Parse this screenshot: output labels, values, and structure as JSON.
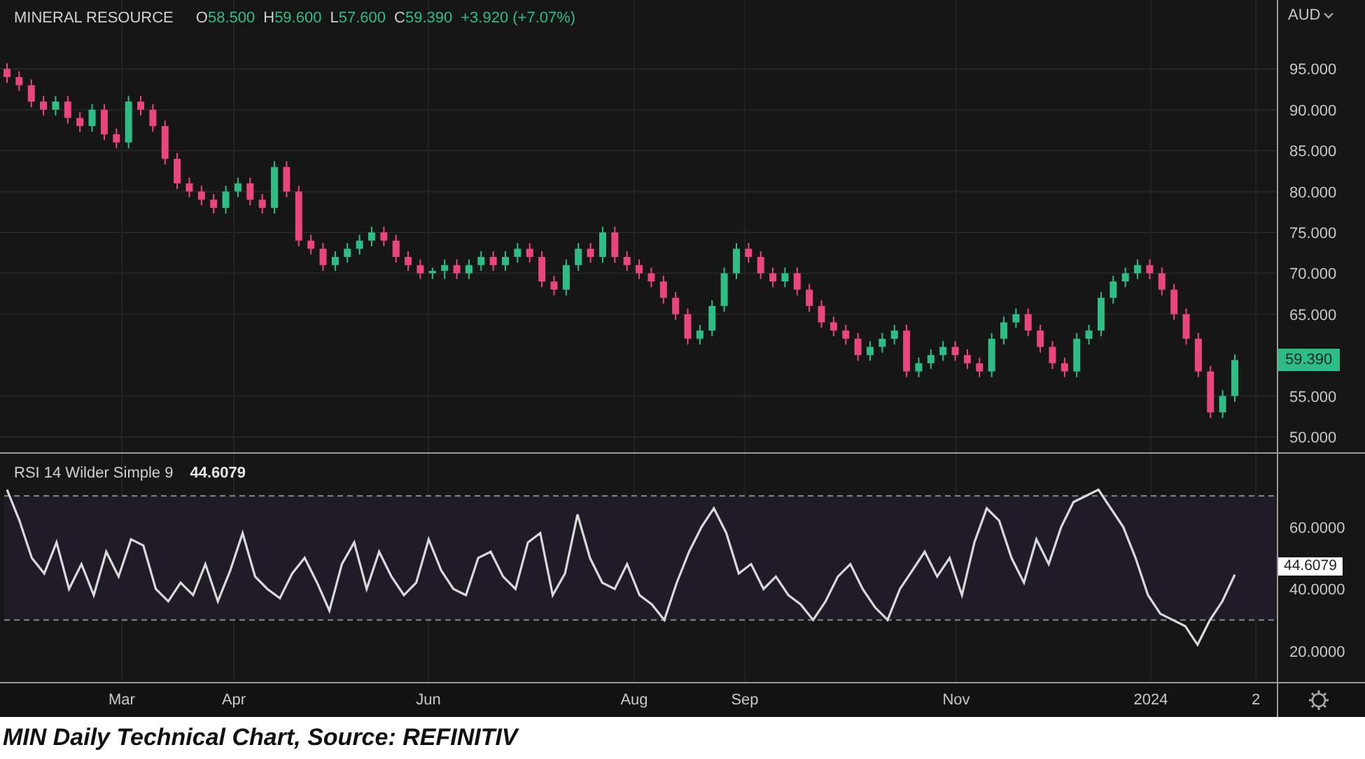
{
  "header": {
    "title": "MINERAL RESOURCE",
    "ohlc": [
      {
        "label": "O",
        "value": "58.500"
      },
      {
        "label": "H",
        "value": "59.600"
      },
      {
        "label": "L",
        "value": "57.600"
      },
      {
        "label": "C",
        "value": "59.390"
      }
    ],
    "change": "+3.920 (+7.07%)"
  },
  "currency": "AUD",
  "price_chart": {
    "last_price": "59.390",
    "chart_data": {
      "type": "candlestick",
      "grid": true,
      "ylim": [
        48.11,
        103.42
      ],
      "yticks": [
        {
          "value": 50,
          "label": "50.000"
        },
        {
          "value": 55,
          "label": "55.000"
        },
        {
          "value": 65,
          "label": "65.000"
        },
        {
          "value": 70,
          "label": "70.000"
        },
        {
          "value": 75,
          "label": "75.000"
        },
        {
          "value": 80,
          "label": "80.000"
        },
        {
          "value": 85,
          "label": "85.000"
        },
        {
          "value": 90,
          "label": "90.000"
        },
        {
          "value": 95,
          "label": "95.000"
        }
      ],
      "ohlc": [
        [
          95,
          95.7,
          93.3,
          94
        ],
        [
          94,
          94.7,
          92.3,
          93
        ],
        [
          93,
          93.7,
          90.3,
          91
        ],
        [
          91,
          91.7,
          89.3,
          90
        ],
        [
          90,
          91.7,
          89.3,
          91
        ],
        [
          91,
          91.7,
          88.3,
          89
        ],
        [
          89,
          89.7,
          87.3,
          88
        ],
        [
          88,
          90.7,
          87.3,
          90
        ],
        [
          90,
          90.7,
          86.3,
          87
        ],
        [
          87,
          87.7,
          85.3,
          86
        ],
        [
          86,
          91.7,
          85.3,
          91
        ],
        [
          91,
          91.7,
          89.3,
          90
        ],
        [
          90,
          90.7,
          87.3,
          88
        ],
        [
          88,
          88.7,
          83.3,
          84
        ],
        [
          84,
          84.7,
          80.3,
          81
        ],
        [
          81,
          81.7,
          79.3,
          80
        ],
        [
          80,
          80.7,
          78.3,
          79
        ],
        [
          79,
          79.7,
          77.3,
          78
        ],
        [
          78,
          80.7,
          77.3,
          80
        ],
        [
          80,
          81.7,
          79.3,
          81
        ],
        [
          81,
          81.7,
          78.3,
          79
        ],
        [
          79,
          79.7,
          77.3,
          78
        ],
        [
          78,
          83.7,
          77.3,
          83
        ],
        [
          83,
          83.7,
          79.3,
          80
        ],
        [
          80,
          80.7,
          73.3,
          74
        ],
        [
          74,
          74.7,
          72.3,
          73
        ],
        [
          73,
          73.7,
          70.3,
          71
        ],
        [
          71,
          72.7,
          70.3,
          72
        ],
        [
          72,
          73.7,
          71.3,
          73
        ],
        [
          73,
          74.7,
          72.3,
          74
        ],
        [
          74,
          75.7,
          73.3,
          75
        ],
        [
          75,
          75.7,
          73.3,
          74
        ],
        [
          74,
          74.7,
          71.3,
          72
        ],
        [
          72,
          72.7,
          70.3,
          71
        ],
        [
          71,
          71.7,
          69.3,
          70
        ],
        [
          70,
          70.7,
          69.3,
          70.3
        ],
        [
          70.3,
          71.7,
          69.3,
          71
        ],
        [
          71,
          71.7,
          69.3,
          70
        ],
        [
          70,
          71.7,
          69.3,
          71
        ],
        [
          71,
          72.7,
          70.3,
          72
        ],
        [
          72,
          72.7,
          70.3,
          71
        ],
        [
          71,
          72.7,
          70.3,
          72
        ],
        [
          72,
          73.7,
          71.3,
          73
        ],
        [
          73,
          73.7,
          71.3,
          72
        ],
        [
          72,
          72.7,
          68.3,
          69
        ],
        [
          69,
          69.7,
          67.3,
          68
        ],
        [
          68,
          71.7,
          67.3,
          71
        ],
        [
          71,
          73.7,
          70.3,
          73
        ],
        [
          73,
          73.7,
          71.3,
          72
        ],
        [
          72,
          75.7,
          71.3,
          75
        ],
        [
          75,
          75.7,
          71.3,
          72
        ],
        [
          72,
          72.7,
          70.3,
          71
        ],
        [
          71,
          71.7,
          69.3,
          70
        ],
        [
          70,
          70.7,
          68.3,
          69
        ],
        [
          69,
          69.7,
          66.3,
          67
        ],
        [
          67,
          67.7,
          64.3,
          65
        ],
        [
          65,
          65.7,
          61.3,
          62
        ],
        [
          62,
          63.7,
          61.3,
          63
        ],
        [
          63,
          66.7,
          62.3,
          66
        ],
        [
          66,
          70.7,
          65.3,
          70
        ],
        [
          70,
          73.7,
          69.3,
          73
        ],
        [
          73,
          73.7,
          71.3,
          72
        ],
        [
          72,
          72.7,
          69.3,
          70
        ],
        [
          70,
          70.7,
          68.3,
          69
        ],
        [
          69,
          70.7,
          68.3,
          70
        ],
        [
          70,
          70.7,
          67.3,
          68
        ],
        [
          68,
          68.7,
          65.3,
          66
        ],
        [
          66,
          66.7,
          63.3,
          64
        ],
        [
          64,
          64.7,
          62.3,
          63
        ],
        [
          63,
          63.7,
          61.3,
          62
        ],
        [
          62,
          62.7,
          59.3,
          60
        ],
        [
          60,
          61.7,
          59.3,
          61
        ],
        [
          61,
          62.7,
          60.3,
          62
        ],
        [
          62,
          63.7,
          61.3,
          63
        ],
        [
          63,
          63.7,
          57.3,
          58
        ],
        [
          58,
          59.7,
          57.3,
          59
        ],
        [
          59,
          60.7,
          58.3,
          60
        ],
        [
          60,
          61.7,
          59.3,
          61
        ],
        [
          61,
          61.7,
          59.3,
          60
        ],
        [
          60,
          60.7,
          58.3,
          59
        ],
        [
          59,
          59.7,
          57.3,
          58
        ],
        [
          58,
          62.7,
          57.3,
          62
        ],
        [
          62,
          64.7,
          61.3,
          64
        ],
        [
          64,
          65.7,
          63.3,
          65
        ],
        [
          65,
          65.7,
          62.3,
          63
        ],
        [
          63,
          63.7,
          60.3,
          61
        ],
        [
          61,
          61.7,
          58.3,
          59
        ],
        [
          59,
          59.7,
          57.3,
          58
        ],
        [
          58,
          62.7,
          57.3,
          62
        ],
        [
          62,
          63.7,
          61.3,
          63
        ],
        [
          63,
          67.7,
          62.3,
          67
        ],
        [
          67,
          69.7,
          66.3,
          69
        ],
        [
          69,
          70.7,
          68.3,
          70
        ],
        [
          70,
          71.7,
          69.3,
          71
        ],
        [
          71,
          71.7,
          69.3,
          70
        ],
        [
          70,
          70.7,
          67.3,
          68
        ],
        [
          68,
          68.7,
          64.3,
          65
        ],
        [
          65,
          65.7,
          61.3,
          62
        ],
        [
          62,
          62.7,
          57.3,
          58
        ],
        [
          58,
          58.7,
          52.3,
          53
        ],
        [
          53,
          55.7,
          52.3,
          55
        ],
        [
          55,
          60.1,
          54.3,
          59.4
        ]
      ]
    }
  },
  "rsi": {
    "label": "RSI 14 Wilder Simple 9",
    "reading": "44.6079",
    "last_value": "44.6079",
    "chart_data": {
      "type": "line",
      "ylim": [
        10,
        83.6
      ],
      "ref_lines": [
        {
          "axis": "y",
          "value": 30
        },
        {
          "axis": "y",
          "value": 70
        }
      ],
      "bands": [
        {
          "axis": "y",
          "from": 30,
          "to": 70
        }
      ],
      "yticks": [
        {
          "value": 20,
          "label": "20.0000"
        },
        {
          "value": 40,
          "label": "40.0000"
        },
        {
          "value": 60,
          "label": "60.0000"
        }
      ],
      "series": [
        {
          "color": "#d9d9d9",
          "values": [
            72,
            62,
            50,
            45,
            55,
            40,
            48,
            38,
            52,
            44,
            56,
            54,
            40,
            36,
            42,
            38,
            48,
            36,
            46,
            58,
            44,
            40,
            37,
            45,
            50,
            42,
            33,
            48,
            55,
            40,
            52,
            44,
            38,
            42,
            56,
            46,
            40,
            38,
            50,
            52,
            44,
            40,
            55,
            58,
            38,
            45,
            64,
            50,
            42,
            40,
            48,
            38,
            35,
            30,
            42,
            52,
            60,
            66,
            58,
            45,
            48,
            40,
            44,
            38,
            35,
            30,
            36,
            44,
            48,
            40,
            34,
            30,
            40,
            46,
            52,
            44,
            50,
            38,
            55,
            66,
            62,
            50,
            42,
            56,
            48,
            60,
            68,
            70,
            72,
            66,
            60,
            50,
            38,
            32,
            30,
            28,
            22,
            30,
            36,
            44.6
          ]
        }
      ]
    }
  },
  "x_axis": [
    "Mar",
    "Apr",
    "Jun",
    "Aug",
    "Sep",
    "Nov",
    "2024",
    "2"
  ],
  "caption": "MIN Daily Technical Chart, Source: REFINITIV"
}
